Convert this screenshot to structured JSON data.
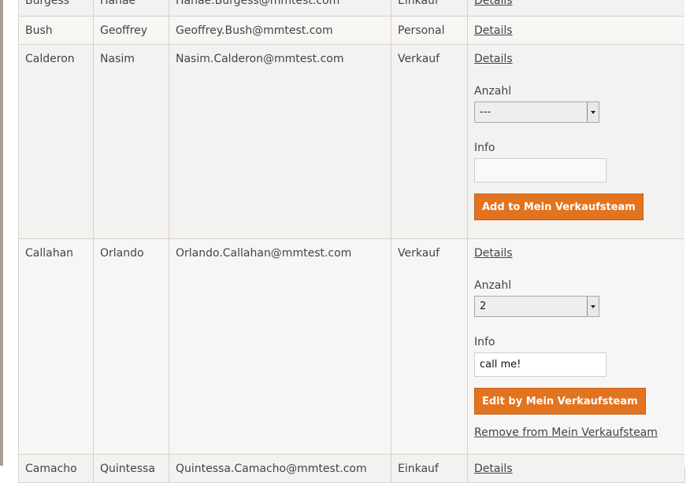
{
  "rows": [
    {
      "last_name": "Burgess",
      "first_name": "Hanae",
      "email": "Hanae.Burgess@mmtest.com",
      "department": "Einkauf",
      "details_label": "Details"
    },
    {
      "last_name": "Bush",
      "first_name": "Geoffrey",
      "email": "Geoffrey.Bush@mmtest.com",
      "department": "Personal",
      "details_label": "Details"
    },
    {
      "last_name": "Calderon",
      "first_name": "Nasim",
      "email": "Nasim.Calderon@mmtest.com",
      "department": "Verkauf",
      "details_label": "Details",
      "anzahl_label": "Anzahl",
      "anzahl_value": "---",
      "info_label": "Info",
      "info_value": "",
      "action_label": "Add to Mein Verkaufsteam"
    },
    {
      "last_name": "Callahan",
      "first_name": "Orlando",
      "email": "Orlando.Callahan@mmtest.com",
      "department": "Verkauf",
      "details_label": "Details",
      "anzahl_label": "Anzahl",
      "anzahl_value": "2",
      "info_label": "Info",
      "info_value": "call me!",
      "action_label": "Edit by Mein Verkaufsteam",
      "remove_label": "Remove from Mein Verkaufsteam"
    },
    {
      "last_name": "Camacho",
      "first_name": "Quintessa",
      "email": "Quintessa.Camacho@mmtest.com",
      "department": "Einkauf",
      "details_label": "Details"
    }
  ],
  "colors": {
    "accent_button": "#e2731f",
    "row_bg_odd": "#f3f2f0",
    "row_bg_even": "#f7f6f5",
    "border": "#d7d2cc"
  },
  "icons": {
    "select_arrow": "chevron-down-icon"
  }
}
